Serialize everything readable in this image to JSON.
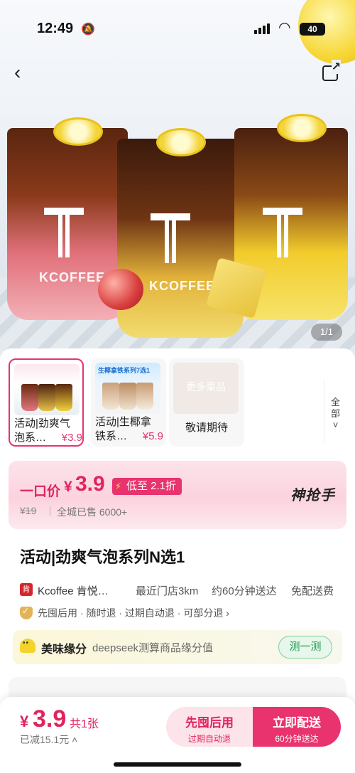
{
  "status": {
    "time": "12:49",
    "battery": "40"
  },
  "hero": {
    "brand_text": "KCOFFEE",
    "image_counter": "1/1"
  },
  "variants": [
    {
      "line1": "活动|劲爽气",
      "line2": "泡系…",
      "price": "¥3.9",
      "selected": true
    },
    {
      "line1": "活动|生椰拿",
      "line2": "铁系…",
      "price": "¥5.9",
      "thumb_tag": "生椰拿铁系列7选1",
      "selected": false
    },
    {
      "thumb_text": "更多菜品",
      "wait_text": "敬请期待",
      "selected": false
    }
  ],
  "all_toggle": "全部",
  "price_card": {
    "label": "一口价",
    "yen": "¥",
    "price": "3.9",
    "discount": "低至 2.1折",
    "original_price": "¥19",
    "sold": "全城已售 6000+",
    "brand": "神抢手"
  },
  "product": {
    "title": "活动|劲爽气泡系列N选1"
  },
  "store": {
    "logo_text": "肯",
    "name": "Kcoffee 肯悦…",
    "distance": "最近门店3km",
    "eta": "约60分钟送达",
    "fee": "免配送费"
  },
  "service": {
    "text": "先囤后用 · 随时退 · 过期自动退 · 可部分退 ›"
  },
  "match": {
    "title": "美味缘分",
    "desc": "deepseek测算商品缘分值",
    "button": "测一测"
  },
  "bottom": {
    "yen": "¥",
    "price": "3.9",
    "qty": "共1张",
    "saved": "已减15.1元 ˄",
    "btn_later": {
      "main": "先囤后用",
      "sub": "过期自动退"
    },
    "btn_now": {
      "main": "立即配送",
      "sub": "60分钟送达"
    }
  },
  "colors": {
    "accent": "#e8336e",
    "accent_light": "#fde3ea",
    "green": "#1e9a4c"
  }
}
